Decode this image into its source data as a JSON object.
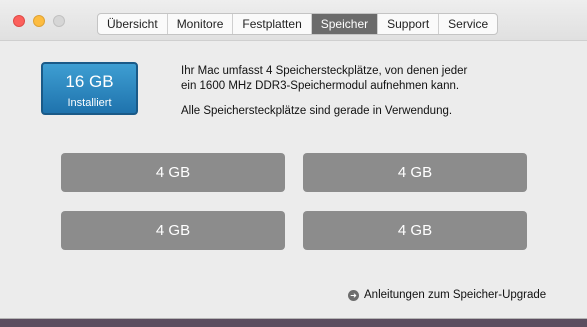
{
  "tabs": [
    {
      "label": "Übersicht"
    },
    {
      "label": "Monitore"
    },
    {
      "label": "Festplatten"
    },
    {
      "label": "Speicher"
    },
    {
      "label": "Support"
    },
    {
      "label": "Service"
    }
  ],
  "active_tab": "Speicher",
  "memory": {
    "total": "16 GB",
    "installed_label": "Installiert"
  },
  "description": {
    "line1": "Ihr Mac umfasst 4 Speichersteckplätze, von denen jeder",
    "line2": "ein 1600 MHz DDR3-Speichermodul aufnehmen kann.",
    "line3": "Alle Speichersteckplätze sind gerade in Verwendung."
  },
  "slots": [
    {
      "label": "4 GB"
    },
    {
      "label": "4 GB"
    },
    {
      "label": "4 GB"
    },
    {
      "label": "4 GB"
    }
  ],
  "upgrade_link": {
    "label": "Anleitungen zum Speicher-Upgrade",
    "icon": "arrow-circle-icon"
  },
  "colors": {
    "badge": "#2a86c0",
    "slot": "#8c8c8c",
    "active_tab": "#6b6b6b"
  }
}
